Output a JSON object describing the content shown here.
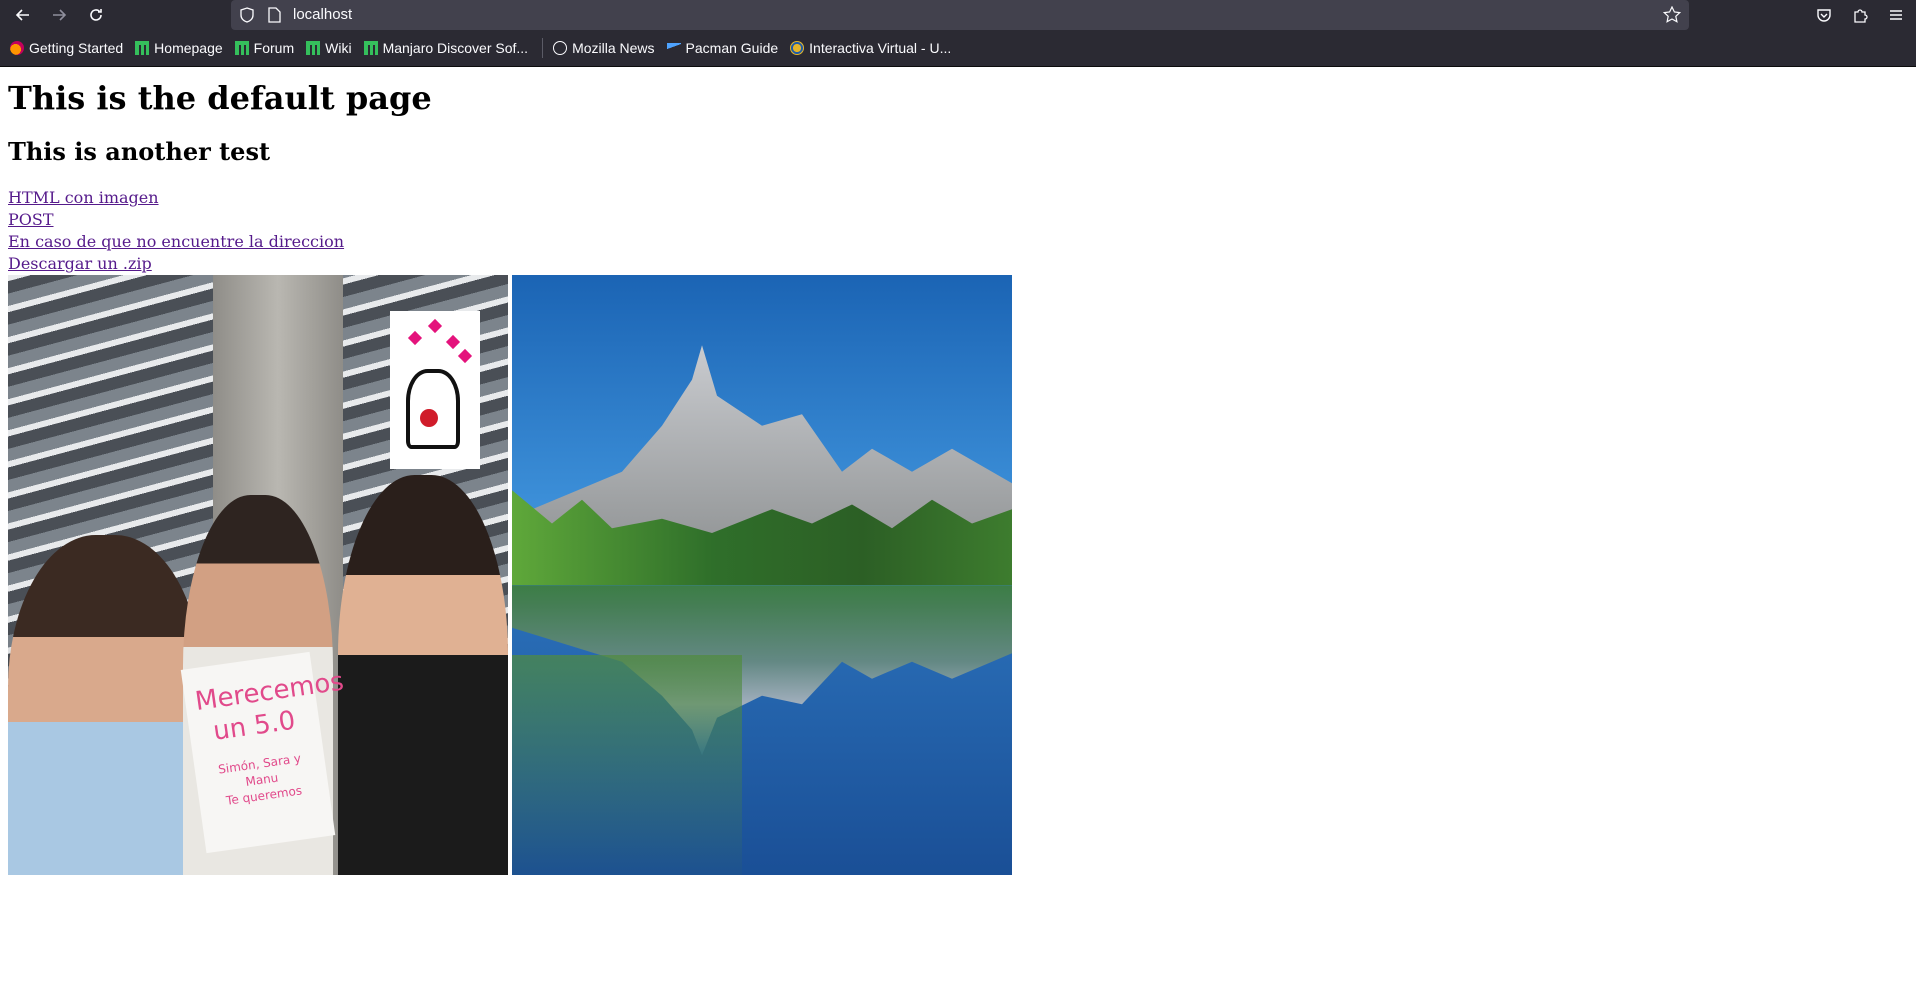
{
  "browser": {
    "url": "localhost",
    "bookmarks": [
      {
        "label": "Getting Started",
        "icon": "firefox-icon"
      },
      {
        "label": "Homepage",
        "icon": "manjaro-icon"
      },
      {
        "label": "Forum",
        "icon": "manjaro-icon"
      },
      {
        "label": "Wiki",
        "icon": "manjaro-icon"
      },
      {
        "label": "Manjaro Discover Sof...",
        "icon": "manjaro-icon"
      },
      {
        "label": "Mozilla News",
        "icon": "globe-icon"
      },
      {
        "label": "Pacman Guide",
        "icon": "pacman-icon"
      },
      {
        "label": "Interactiva Virtual - U...",
        "icon": "interactiva-icon"
      }
    ]
  },
  "page": {
    "title": "This is the default page",
    "subtitle": "This is another test",
    "links": [
      "HTML con imagen",
      "POST",
      "En caso de que no encuentre la direccion",
      "Descargar un .zip"
    ],
    "photo1": {
      "sign_lines": [
        "Merecemos",
        "un 5.0"
      ],
      "sign_names": "Simón, Sara y Manu",
      "sign_note": "Te queremos"
    }
  },
  "colors": {
    "chrome_bg": "#2b2a33",
    "urlbar_bg": "#42414d",
    "link_visited": "#551a8b"
  }
}
